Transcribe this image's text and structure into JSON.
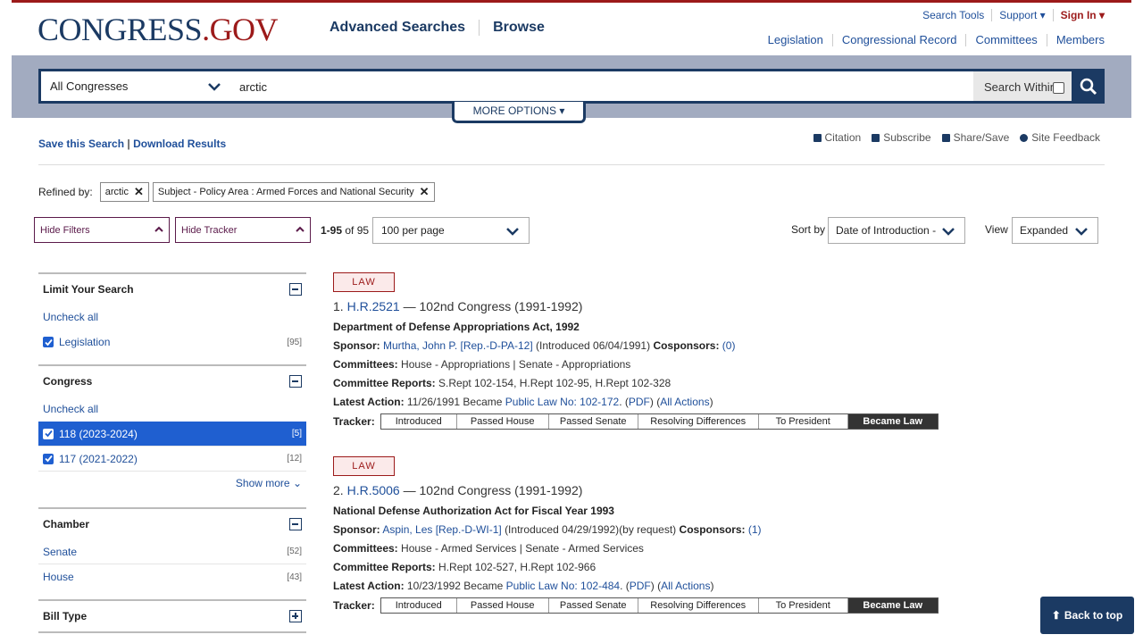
{
  "header": {
    "logo_main": "CONGRESS",
    "logo_dot": ".",
    "logo_gov": "GOV",
    "nav": [
      "Advanced Searches",
      "Browse"
    ],
    "top_links": [
      "Search Tools",
      "Support ▾",
      "Sign In ▾"
    ],
    "sub_nav": [
      "Legislation",
      "Congressional Record",
      "Committees",
      "Members"
    ]
  },
  "search": {
    "congress_select": "All Congresses",
    "query": "arctic",
    "search_within": "Search Within",
    "more_options": "MORE OPTIONS ▾"
  },
  "actions": {
    "save_search": "Save this Search",
    "divider": "|",
    "download": "Download Results",
    "tools": [
      "Citation",
      "Subscribe",
      "Share/Save",
      "Site Feedback"
    ]
  },
  "refined": {
    "label": "Refined by:",
    "chips": [
      "arctic",
      "Subject - Policy Area : Armed Forces and National Security"
    ]
  },
  "controls": {
    "hide_filters": "Hide Filters",
    "hide_tracker": "Hide Tracker",
    "count_range": "1-95",
    "count_of": "of 95",
    "per_page": "100 per page",
    "sort_label": "Sort by",
    "sort_value": "Date of Introduction -",
    "view_label": "View",
    "view_value": "Expanded"
  },
  "facets": {
    "limit": {
      "title": "Limit Your Search",
      "uncheck": "Uncheck all",
      "items": [
        {
          "label": "Legislation",
          "count": "[95]"
        }
      ]
    },
    "congress": {
      "title": "Congress",
      "uncheck": "Uncheck all",
      "items": [
        {
          "label": "118 (2023-2024)",
          "count": "[5]"
        },
        {
          "label": "117 (2021-2022)",
          "count": "[12]"
        }
      ],
      "show_more": "Show more"
    },
    "chamber": {
      "title": "Chamber",
      "items": [
        {
          "label": "Senate",
          "count": "[52]"
        },
        {
          "label": "House",
          "count": "[43]"
        }
      ]
    },
    "billtype": {
      "title": "Bill Type"
    }
  },
  "results": [
    {
      "badge": "LAW",
      "num": "1.",
      "bill": "H.R.2521",
      "congress": "— 102nd Congress (1991-1992)",
      "name": "Department of Defense Appropriations Act, 1992",
      "sponsor_label": "Sponsor:",
      "sponsor": "Murtha, John P. [Rep.-D-PA-12]",
      "introduced": "(Introduced 06/04/1991)",
      "cosponsors_label": "Cosponsors:",
      "cosponsors": "(0)",
      "committees_label": "Committees:",
      "committees": "House - Appropriations | Senate - Appropriations",
      "reports_label": "Committee Reports:",
      "reports": "S.Rept 102-154, H.Rept 102-95, H.Rept 102-328",
      "action_label": "Latest Action:",
      "action_text": "11/26/1991 Became",
      "public_law": "Public Law No: 102-172",
      "pdf": "PDF",
      "all_actions": "All Actions"
    },
    {
      "badge": "LAW",
      "num": "2.",
      "bill": "H.R.5006",
      "congress": "— 102nd Congress (1991-1992)",
      "name": "National Defense Authorization Act for Fiscal Year 1993",
      "sponsor_label": "Sponsor:",
      "sponsor": "Aspin, Les [Rep.-D-WI-1]",
      "introduced": "(Introduced 04/29/1992)(by request)",
      "cosponsors_label": "Cosponsors:",
      "cosponsors": "(1)",
      "committees_label": "Committees:",
      "committees": "House - Armed Services | Senate - Armed Services",
      "reports_label": "Committee Reports:",
      "reports": "H.Rept 102-527, H.Rept 102-966",
      "action_label": "Latest Action:",
      "action_text": "10/23/1992 Became",
      "public_law": "Public Law No: 102-484",
      "pdf": "PDF",
      "all_actions": "All Actions"
    }
  ],
  "tracker": {
    "label": "Tracker:",
    "steps": [
      "Introduced",
      "Passed House",
      "Passed Senate",
      "Resolving Differences",
      "To President",
      "Became Law"
    ]
  },
  "back_to_top": "Back to top"
}
